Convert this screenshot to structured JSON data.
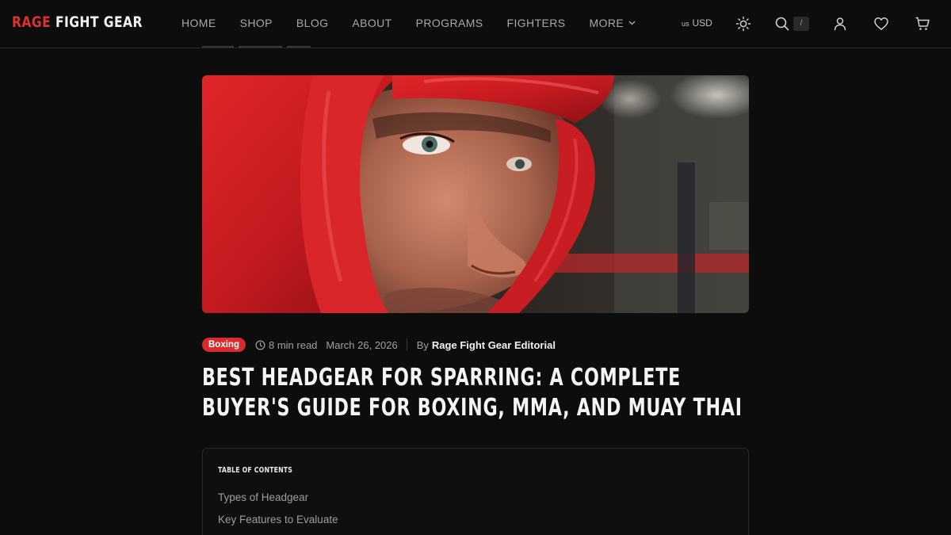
{
  "brand": {
    "name_part1": "RAGE",
    "name_part2": "FIGHT GEAR",
    "accent_color": "#e03131"
  },
  "nav": {
    "items": [
      {
        "label": "HOME"
      },
      {
        "label": "SHOP"
      },
      {
        "label": "BLOG"
      },
      {
        "label": "ABOUT"
      },
      {
        "label": "PROGRAMS"
      },
      {
        "label": "FIGHTERS"
      },
      {
        "label": "MORE"
      }
    ]
  },
  "tools": {
    "currency_flag": "us",
    "currency_code": "USD",
    "search_shortcut": "/",
    "icons": [
      "sun-icon",
      "search-icon",
      "user-icon",
      "heart-icon",
      "cart-icon"
    ]
  },
  "article": {
    "category": "Boxing",
    "category_color": "#d92b2b",
    "read_time": "8 min read",
    "date": "March 26, 2026",
    "by_label": "By",
    "author": "Rage Fight Gear Editorial",
    "title": "Best Headgear for Sparring: A Complete Buyer's Guide for Boxing, MMA, and Muay Thai",
    "hero_alt": "Boxer wearing red headgear"
  },
  "toc": {
    "heading": "TABLE OF CONTENTS",
    "items": [
      {
        "label": "Types of Headgear"
      },
      {
        "label": "Key Features to Evaluate"
      }
    ]
  }
}
